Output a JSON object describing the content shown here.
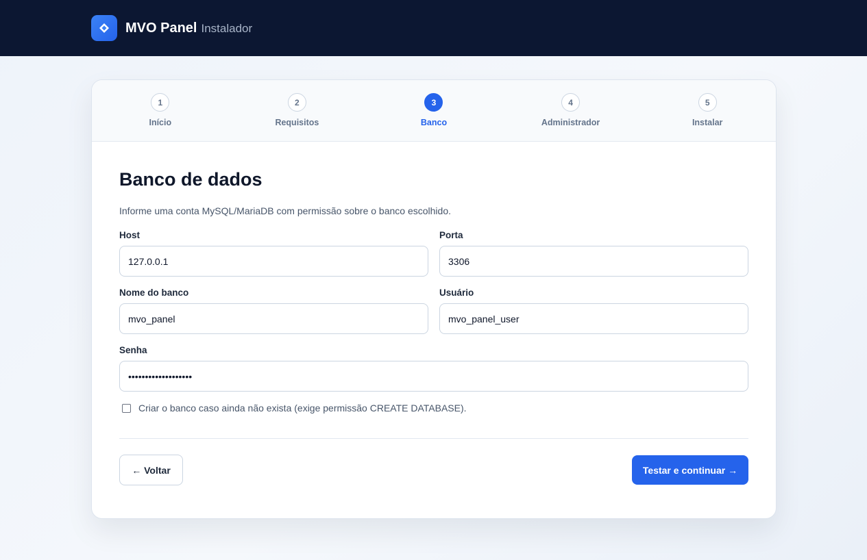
{
  "header": {
    "logo_icon": "diamond-icon",
    "brand": "MVO Panel",
    "subtitle": "Instalador"
  },
  "steps": [
    {
      "number": "1",
      "label": "Início",
      "active": false
    },
    {
      "number": "2",
      "label": "Requisitos",
      "active": false
    },
    {
      "number": "3",
      "label": "Banco",
      "active": true
    },
    {
      "number": "4",
      "label": "Administrador",
      "active": false
    },
    {
      "number": "5",
      "label": "Instalar",
      "active": false
    }
  ],
  "form": {
    "title": "Banco de dados",
    "description": "Informe uma conta MySQL/MariaDB com permissão sobre o banco escolhido.",
    "host": {
      "label": "Host",
      "value": "127.0.0.1"
    },
    "port": {
      "label": "Porta",
      "value": "3306"
    },
    "database": {
      "label": "Nome do banco",
      "value": "mvo_panel"
    },
    "user": {
      "label": "Usuário",
      "value": "mvo_panel_user"
    },
    "password": {
      "label": "Senha",
      "value": "•••••••••••••••••••"
    },
    "create_db": {
      "label": "Criar o banco caso ainda não exista (exige permissão CREATE DATABASE).",
      "checked": false
    }
  },
  "actions": {
    "back_label": "← Voltar",
    "next_label": "Testar e continuar →"
  },
  "colors": {
    "topbar": "#0c1732",
    "accent": "#2563eb"
  }
}
